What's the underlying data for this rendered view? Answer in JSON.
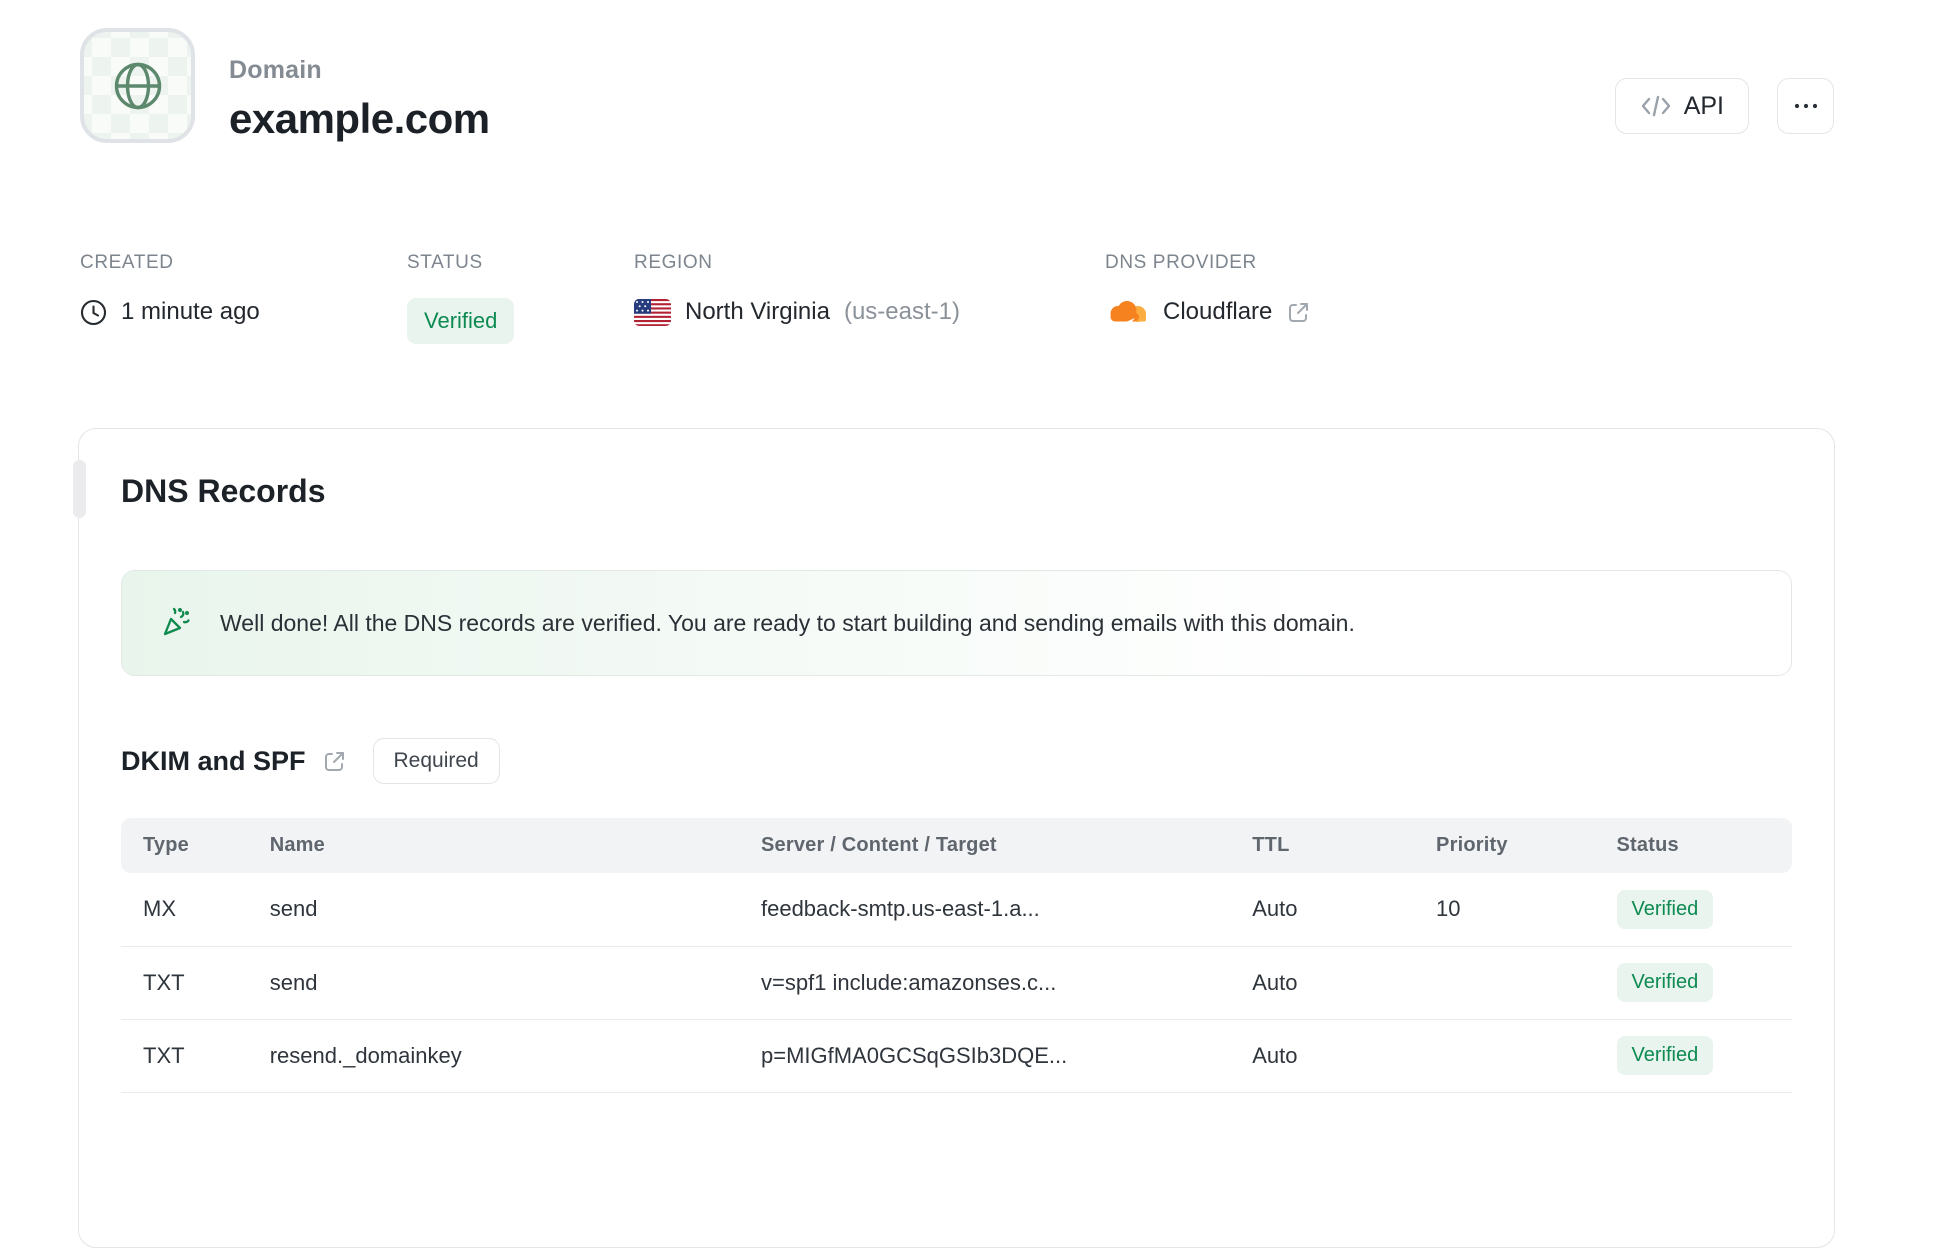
{
  "header": {
    "entity_label": "Domain",
    "title": "example.com",
    "api_button": "API"
  },
  "meta": {
    "created": {
      "label": "CREATED",
      "value": "1 minute ago"
    },
    "status": {
      "label": "STATUS",
      "value": "Verified"
    },
    "region": {
      "label": "REGION",
      "value": "North Virginia",
      "code": "(us-east-1)"
    },
    "provider": {
      "label": "DNS PROVIDER",
      "value": "Cloudflare"
    }
  },
  "card": {
    "heading": "DNS Records",
    "banner_text": "Well done! All the DNS records are verified. You are ready to start building and sending emails with this domain.",
    "section": {
      "title": "DKIM and SPF",
      "badge": "Required"
    },
    "table": {
      "headers": [
        "Type",
        "Name",
        "Server / Content / Target",
        "TTL",
        "Priority",
        "Status"
      ],
      "rows": [
        {
          "type": "MX",
          "name": "send",
          "content": "feedback-smtp.us-east-1.a...",
          "ttl": "Auto",
          "priority": "10",
          "status": "Verified"
        },
        {
          "type": "TXT",
          "name": "send",
          "content": "v=spf1 include:amazonses.c...",
          "ttl": "Auto",
          "priority": "",
          "status": "Verified"
        },
        {
          "type": "TXT",
          "name": "resend._domainkey",
          "content": "p=MIGfMA0GCSqGSIb3DQE...",
          "ttl": "Auto",
          "priority": "",
          "status": "Verified"
        }
      ]
    }
  },
  "icons": {
    "avatar": "globe-icon",
    "created": "clock-icon",
    "region": "us-flag-icon",
    "provider": "cloudflare-icon",
    "provider_action": "external-link-icon",
    "banner": "party-popper-icon",
    "api": "code-icon",
    "more": "ellipsis-icon"
  },
  "colors": {
    "status_green_text": "#0D8A52",
    "status_green_bg": "#E8F4ED",
    "globe_green": "#5C886D",
    "cloudflare_orange": "#F6821F",
    "cloudflare_light_orange": "#FBAD41",
    "flag_red": "#B22234",
    "flag_blue": "#273C7F",
    "border_gray": "#E3E5E9",
    "table_header_bg": "#F2F3F5"
  }
}
